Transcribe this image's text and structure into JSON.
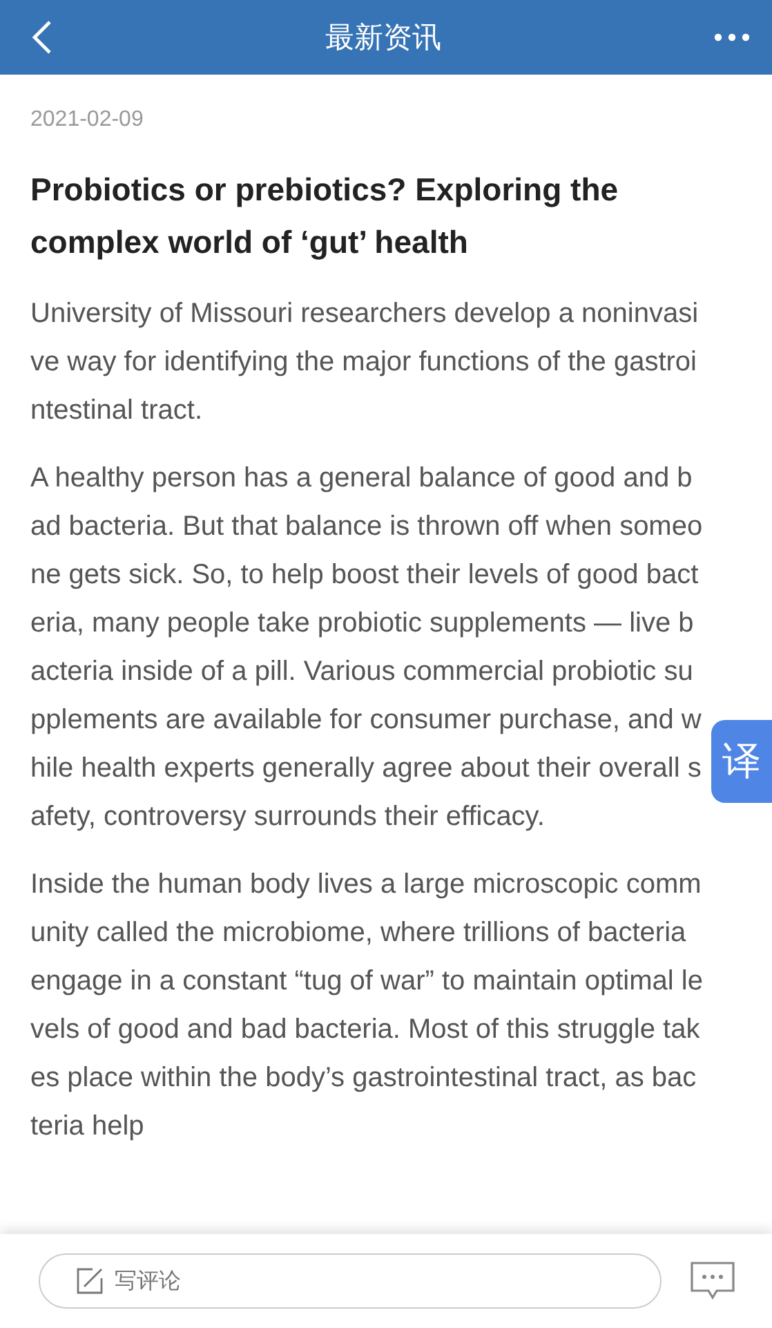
{
  "header": {
    "title": "最新资讯"
  },
  "article": {
    "date": "2021-02-09",
    "title": "Probiotics or prebiotics? Exploring the complex world of ‘gut’ health",
    "paragraphs": [
      "University of Missouri researchers develop a noninvasive way for identifying the major functions of the gastrointestinal tract.",
      "A healthy person has a general balance of good and bad bacteria. But that balance is thrown off when someone gets sick. So, to help boost their levels of good bacteria, many people take probiotic supplements — live bacteria inside of a pill. Various commercial probiotic supplements are available for consumer purchase, and while health experts generally agree about their overall safety, controversy surrounds their efficacy.",
      "Inside the human body lives a large microscopic community called the microbiome, where trillions of bacteria engage in a constant “tug of war” to maintain optimal levels of good and bad bacteria. Most of this struggle takes place within the body’s gastrointestinal tract, as bacteria help"
    ]
  },
  "translate_button": {
    "label": "译"
  },
  "comment_bar": {
    "placeholder": "写评论"
  }
}
